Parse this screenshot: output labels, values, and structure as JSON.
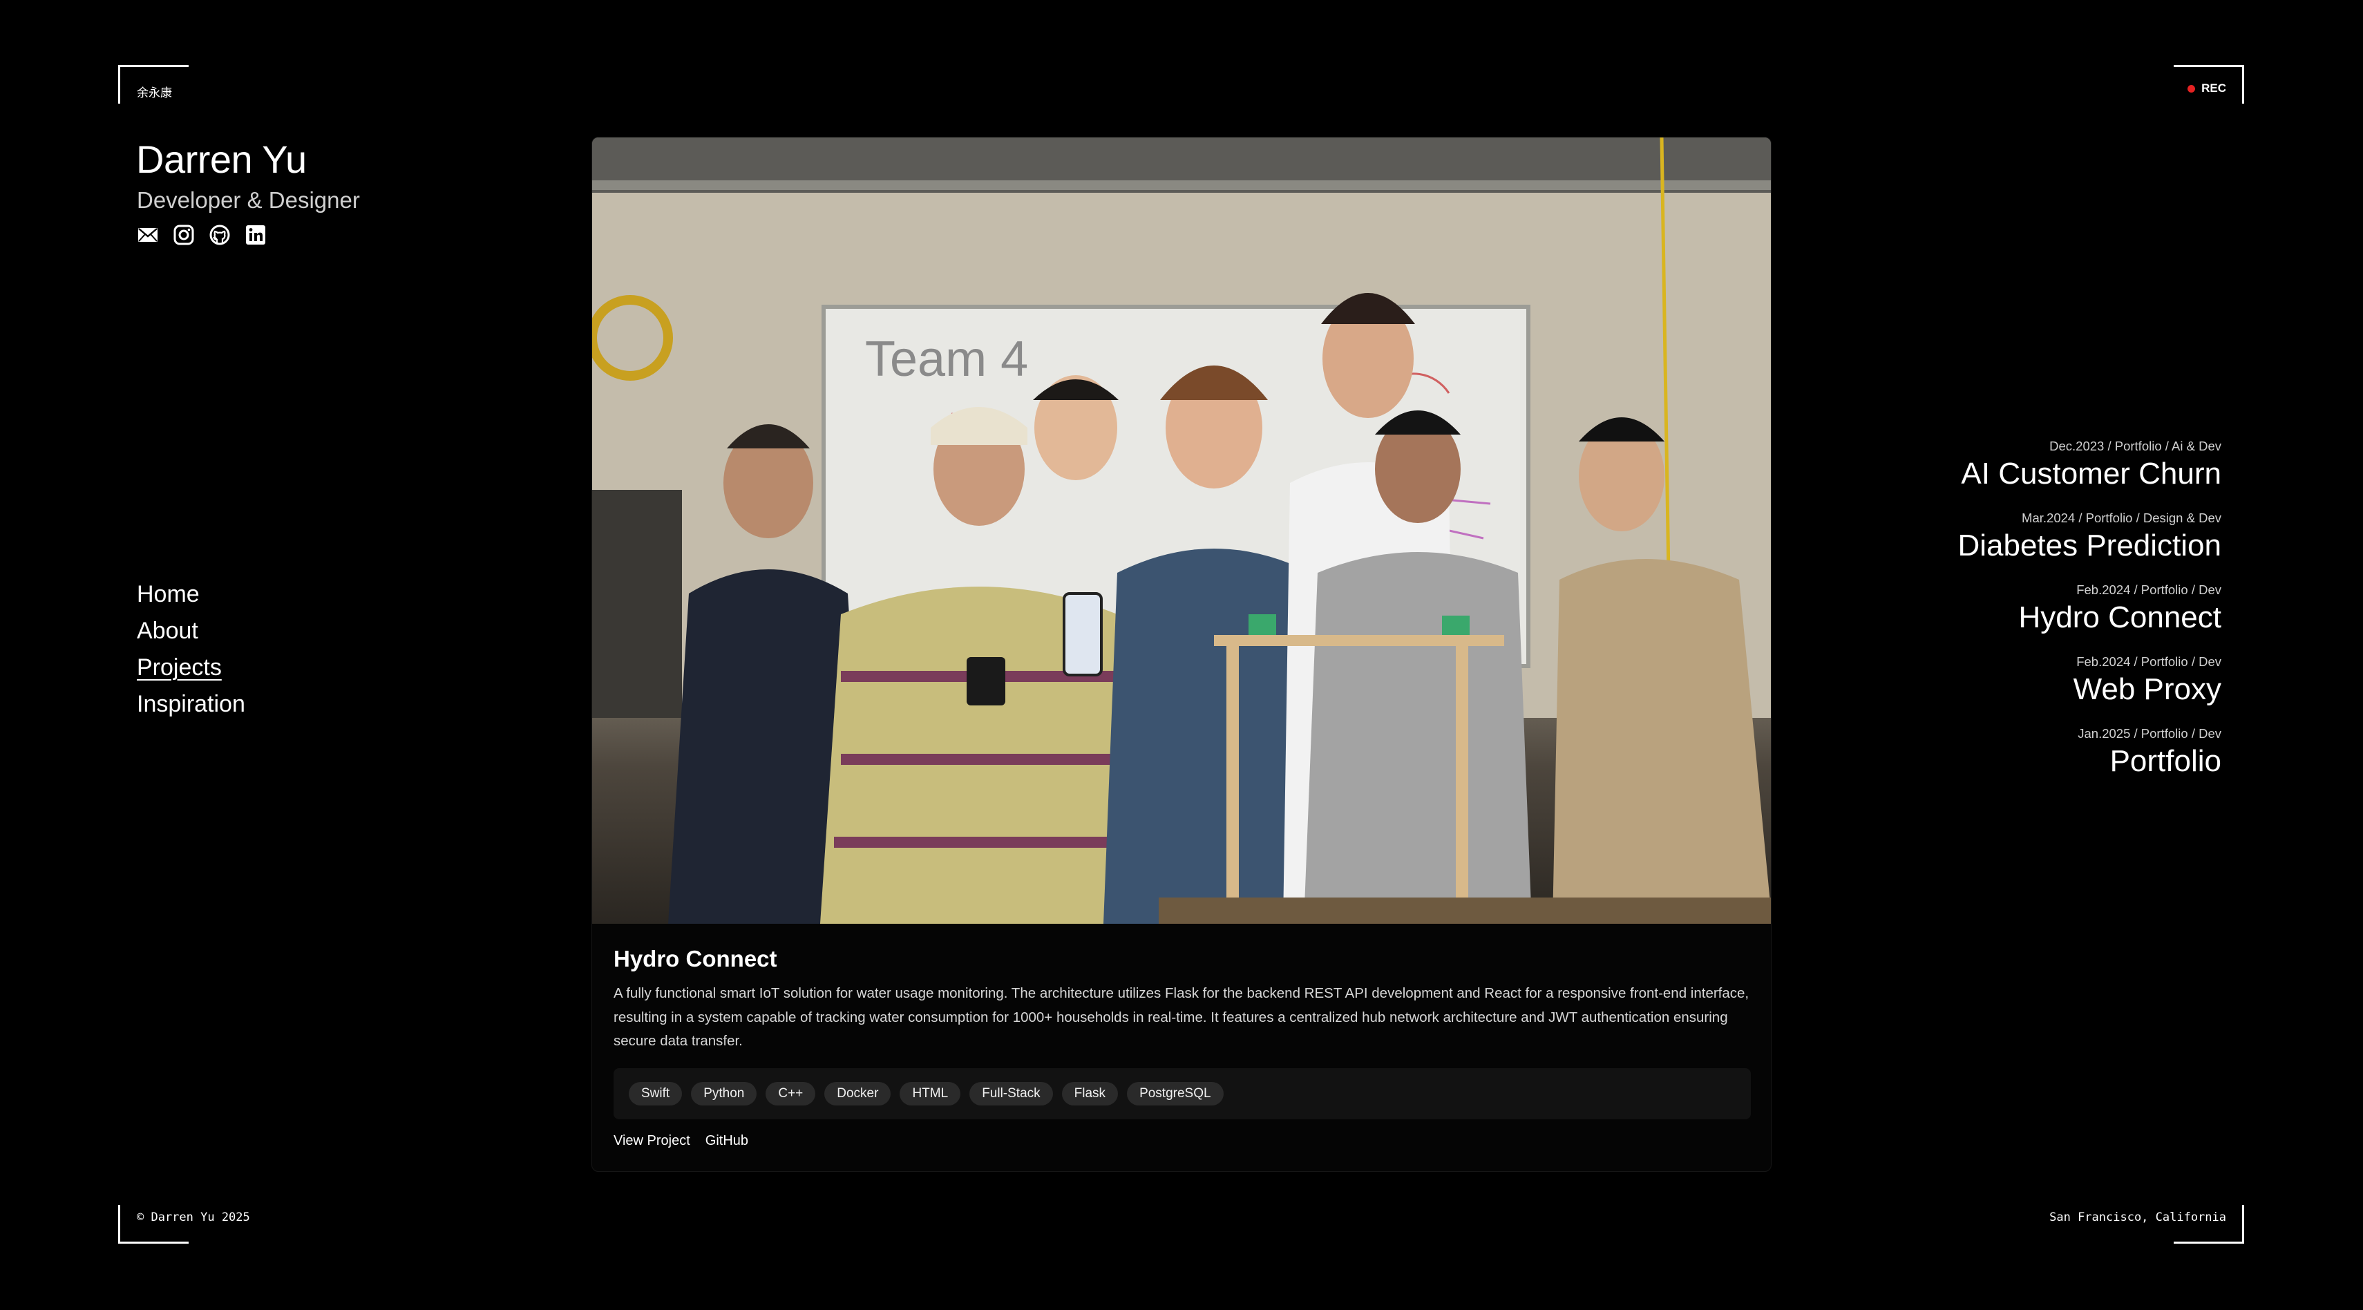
{
  "brand": {
    "chinese_name": "余永康",
    "name": "Darren Yu",
    "role": "Developer & Designer",
    "rec_label": "REC",
    "rec_color": "#e52222"
  },
  "socials": [
    {
      "icon": "mail-icon"
    },
    {
      "icon": "instagram-icon"
    },
    {
      "icon": "github-icon"
    },
    {
      "icon": "linkedin-icon"
    }
  ],
  "nav": {
    "items": [
      "Home",
      "About",
      "Projects",
      "Inspiration"
    ],
    "active": "Projects"
  },
  "featured": {
    "title": "Hydro Connect",
    "description": "A fully functional smart IoT solution for water usage monitoring. The architecture utilizes Flask for the backend REST API development and React for a responsive front-end interface, resulting in a system capable of tracking water consumption for 1000+ households in real-time. It features a centralized hub network architecture and JWT authentication ensuring secure data transfer.",
    "tags": [
      "Swift",
      "Python",
      "C++",
      "Docker",
      "HTML",
      "Full-Stack",
      "Flask",
      "PostgreSQL"
    ],
    "links": [
      "View Project",
      "GitHub"
    ],
    "whiteboard_text": "Team 4"
  },
  "projects": [
    {
      "meta": "Dec.2023 / Portfolio / Ai & Dev",
      "title": "AI Customer Churn"
    },
    {
      "meta": "Mar.2024 / Portfolio / Design & Dev",
      "title": "Diabetes Prediction"
    },
    {
      "meta": "Feb.2024 / Portfolio / Dev",
      "title": "Hydro Connect"
    },
    {
      "meta": "Feb.2024 / Portfolio / Dev",
      "title": "Web Proxy"
    },
    {
      "meta": "Jan.2025 / Portfolio / Dev",
      "title": "Portfolio"
    }
  ],
  "footer": {
    "copyright": "© Darren Yu 2025",
    "location": "San Francisco, California"
  }
}
